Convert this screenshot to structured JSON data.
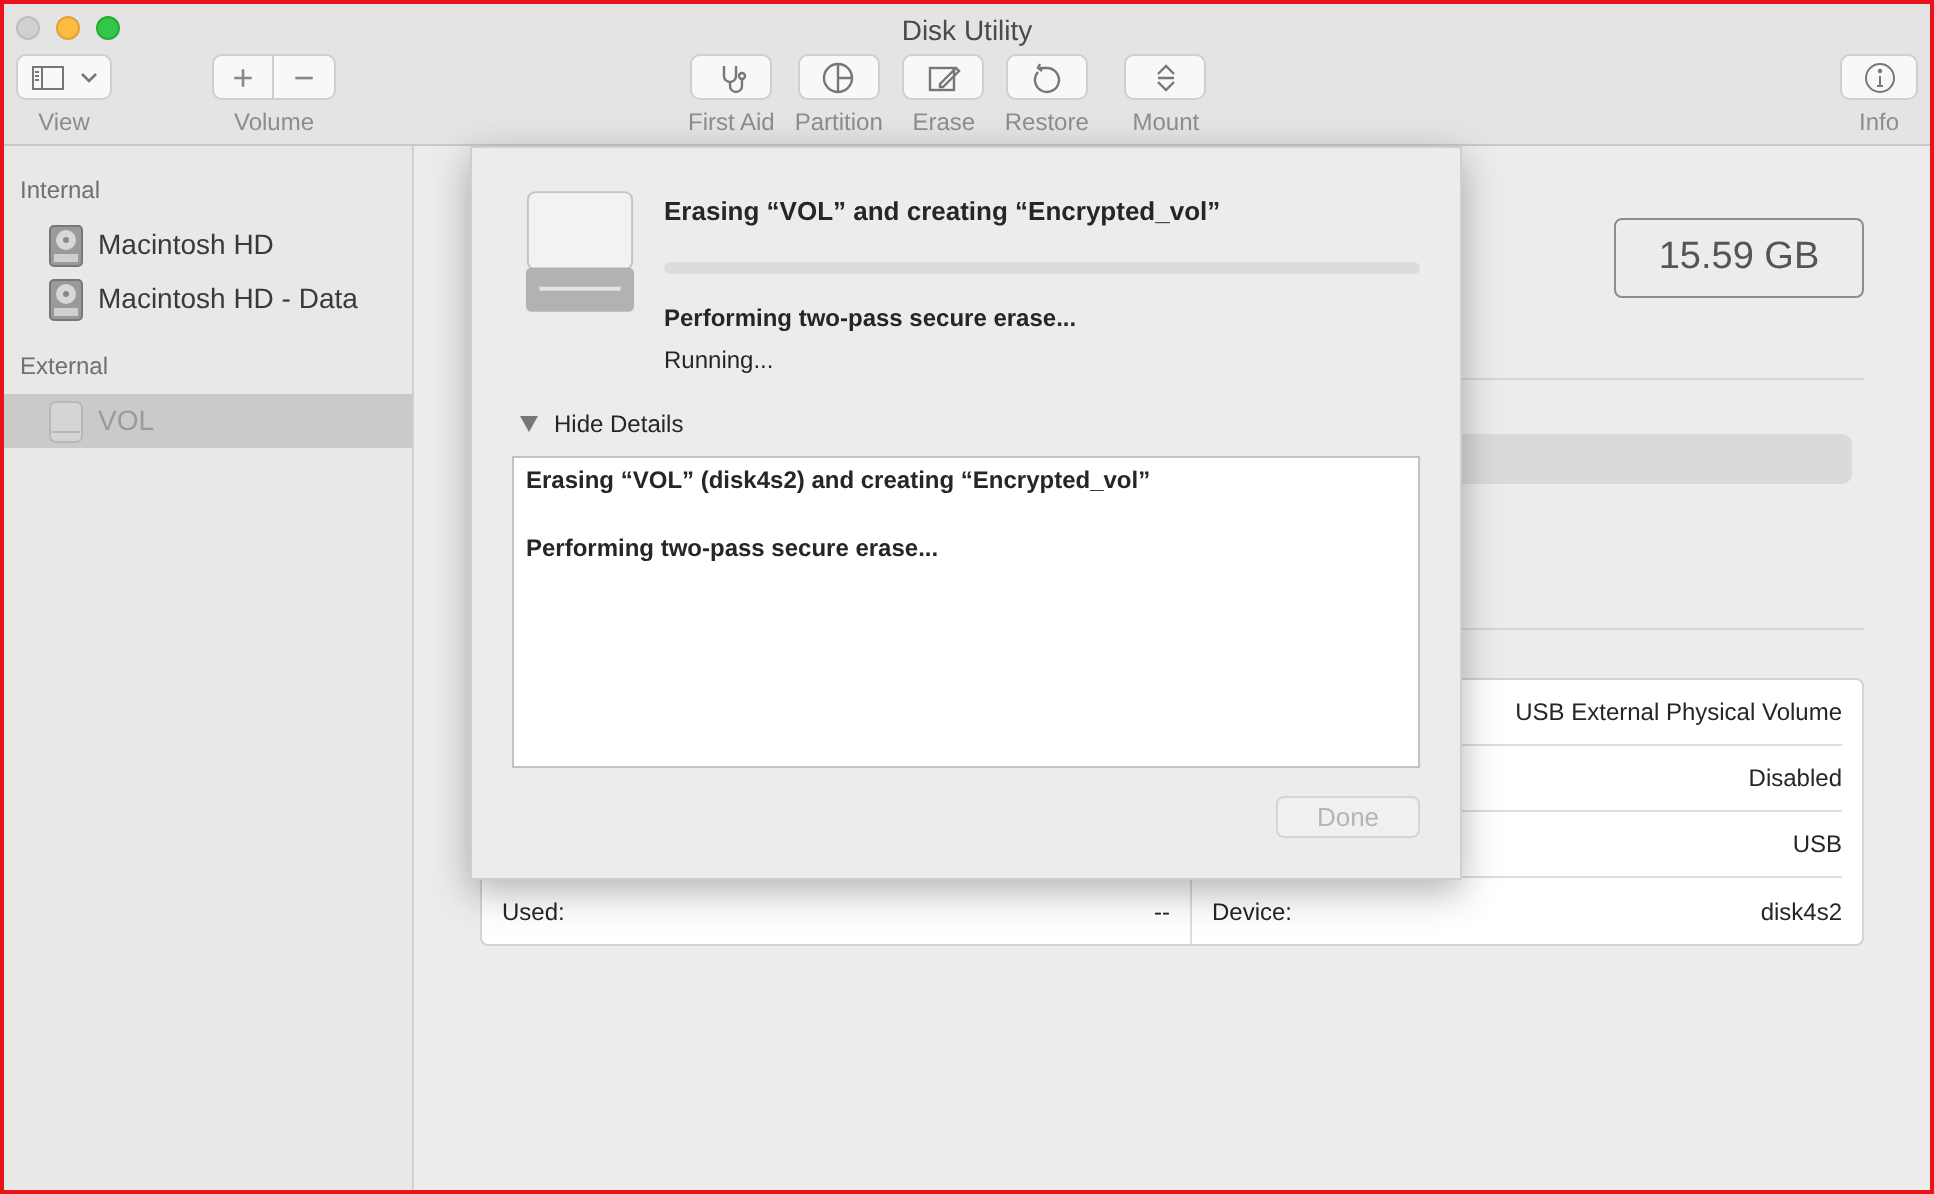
{
  "window": {
    "title": "Disk Utility"
  },
  "toolbar": {
    "groups": [
      {
        "kind": "view",
        "label": "View"
      },
      {
        "kind": "volume",
        "label": "Volume",
        "buttons": [
          "+",
          "−"
        ]
      },
      {
        "kind": "tool",
        "label": "First Aid"
      },
      {
        "kind": "tool",
        "label": "Partition"
      },
      {
        "kind": "tool",
        "label": "Erase"
      },
      {
        "kind": "tool",
        "label": "Restore"
      },
      {
        "kind": "tool",
        "label": "Mount"
      },
      {
        "kind": "info",
        "label": "Info"
      }
    ]
  },
  "sidebar": {
    "sections": [
      {
        "title": "Internal",
        "items": [
          {
            "label": "Macintosh HD",
            "selected": false,
            "mounted": true
          },
          {
            "label": "Macintosh HD - Data",
            "selected": false,
            "mounted": true
          }
        ]
      },
      {
        "title": "External",
        "items": [
          {
            "label": "VOL",
            "selected": true,
            "mounted": false
          }
        ]
      }
    ]
  },
  "capacity": "15.59 GB",
  "info_table": {
    "rows": [
      {
        "right_value": "USB External Physical Volume"
      },
      {
        "right_value": "Disabled"
      },
      {
        "right_value": "USB"
      },
      {
        "left_label": "Used:",
        "left_value": "--",
        "right_label": "Device:",
        "right_value": "disk4s2"
      }
    ]
  },
  "sheet": {
    "title": "Erasing “VOL” and creating “Encrypted_vol”",
    "progress": {
      "level": 0
    },
    "step": "Performing two-pass secure erase...",
    "status": "Running...",
    "details_toggle": {
      "label": "Hide Details",
      "expanded": true
    },
    "log": [
      "Erasing “VOL” (disk4s2) and creating “Encrypted_vol”",
      "Performing two-pass secure erase..."
    ],
    "done_button": {
      "label": "Done",
      "disabled": true
    }
  }
}
